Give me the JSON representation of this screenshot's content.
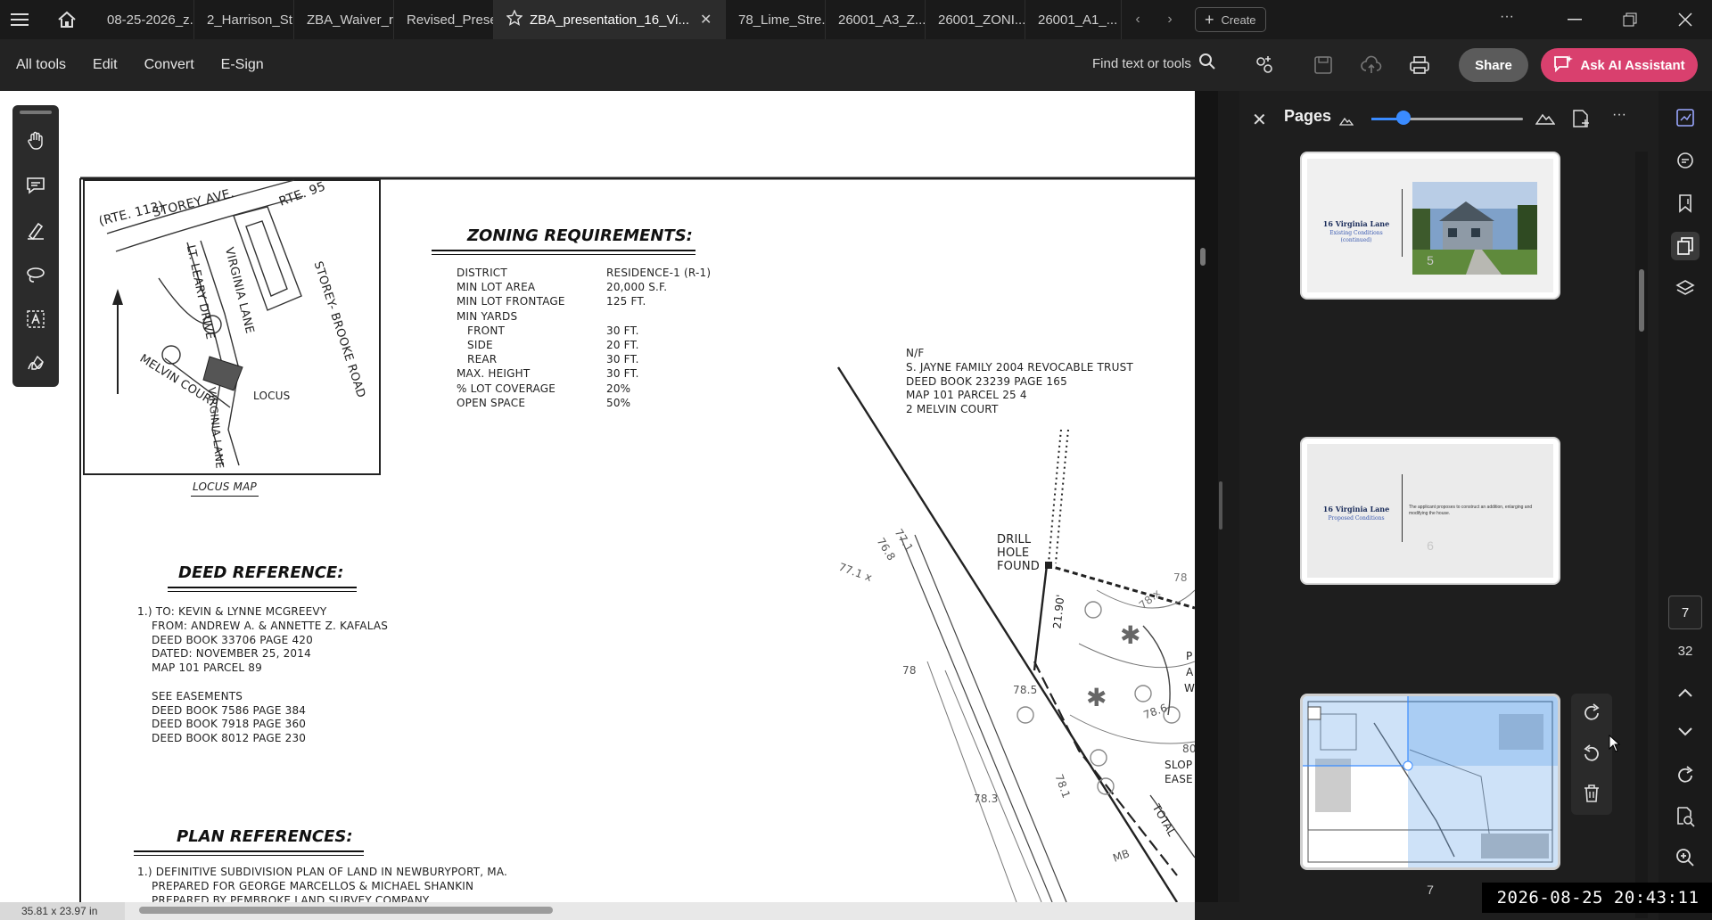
{
  "tabs": [
    {
      "label": "08-25-2026_z..."
    },
    {
      "label": "2_Harrison_St..."
    },
    {
      "label": "ZBA_Waiver_r..."
    },
    {
      "label": "Revised_Prese..."
    },
    {
      "label": "ZBA_presentation_16_Vi...",
      "active": true
    },
    {
      "label": "78_Lime_Stre..."
    },
    {
      "label": "26001_A3_Z..."
    },
    {
      "label": "26001_ZONI..."
    },
    {
      "label": "26001_A1_..."
    }
  ],
  "tabbar": {
    "create_label": "Create",
    "more": "···"
  },
  "menu": {
    "all_tools": "All tools",
    "edit": "Edit",
    "convert": "Convert",
    "esign": "E-Sign"
  },
  "toolbar": {
    "find_label": "Find text or tools",
    "share_label": "Share",
    "ai_label": "Ask AI Assistant"
  },
  "document": {
    "locus": {
      "rte113": "(RTE. 113)",
      "storey_ave": "STOREY AVE.",
      "rte95": "RTE. 95",
      "lt_leary": "LT. LEARY DRIVE",
      "virginia_lane": "VIRGINIA LANE",
      "storey_brooke": "STOREY- BROOKE ROAD",
      "melvin_court": "MELVIN COURT",
      "locus": "LOCUS",
      "virginia_lane2": "VIRGINIA LANE",
      "caption": "LOCUS MAP"
    },
    "zoning": {
      "title": "ZONING REQUIREMENTS:",
      "rows": [
        {
          "label": "DISTRICT",
          "value": "RESIDENCE-1 (R-1)"
        },
        {
          "label": "MIN LOT AREA",
          "value": "20,000 S.F."
        },
        {
          "label": "MIN LOT FRONTAGE",
          "value": "125 FT."
        },
        {
          "label": "MIN YARDS",
          "value": ""
        },
        {
          "label": "   FRONT",
          "value": "30 FT."
        },
        {
          "label": "   SIDE",
          "value": "20 FT."
        },
        {
          "label": "   REAR",
          "value": "30 FT."
        },
        {
          "label": "MAX. HEIGHT",
          "value": "30 FT."
        },
        {
          "label": "% LOT COVERAGE",
          "value": "20%"
        },
        {
          "label": "OPEN SPACE",
          "value": "50%"
        }
      ]
    },
    "deed": {
      "title": "DEED REFERENCE:",
      "lines": [
        "1.) TO: KEVIN & LYNNE MCGREEVY",
        "    FROM: ANDREW A. & ANNETTE Z. KAFALAS",
        "    DEED BOOK 33706 PAGE 420",
        "    DATED: NOVEMBER 25, 2014",
        "    MAP 101 PARCEL 89",
        "",
        "    SEE EASEMENTS",
        "    DEED BOOK 7586 PAGE 384",
        "    DEED BOOK 7918 PAGE 360",
        "    DEED BOOK 8012 PAGE 230"
      ]
    },
    "plan": {
      "title": "PLAN REFERENCES:",
      "lines": [
        "1.) DEFINITIVE SUBDIVISION PLAN OF LAND IN NEWBURYPORT, MA.",
        "    PREPARED FOR GEORGE MARCELLOS & MICHAEL SHANKIN",
        "    PREPARED BY PEMBROKE LAND SURVEY COMPANY"
      ]
    },
    "abutter": {
      "lines": [
        "N/F",
        "S. JAYNE FAMILY 2004 REVOCABLE TRUST",
        "DEED BOOK 23239 PAGE 165",
        "MAP 101 PARCEL 25 4",
        "2 MELVIN COURT"
      ]
    },
    "survey": {
      "drill": "DRILL\nHOLE\nFOUND",
      "dim": "21.90'",
      "e78": "78",
      "e785": "78.5",
      "e78x": "78.x",
      "e771": "77.1",
      "e768": "76.8",
      "e771b": "77.1 x",
      "e78b": "78",
      "e786": "78.6",
      "e781": "78.1",
      "e787": "78.7",
      "e783": "78.3",
      "e80": "80",
      "mb": "MB",
      "slope1": "SLOP",
      "slope2": "EASE",
      "total": "TOTAL",
      "a": "A",
      "w": "W",
      "p": "P"
    },
    "dimensions": "35.81 x 23.97 in"
  },
  "pages_panel": {
    "title": "Pages",
    "thumbs": [
      {
        "num": "5",
        "title": "16 Virginia Lane",
        "subtitle": "Existing Conditions (continued)"
      },
      {
        "num": "6",
        "title": "16 Virginia Lane",
        "subtitle": "Proposed Conditions",
        "body": "The applicant proposes to construct an addition, enlarging and modifying the house."
      },
      {
        "num": "7",
        "selected": true
      }
    ]
  },
  "page_nav": {
    "current": "7",
    "total": "32"
  },
  "timestamp": "2026-08-25  20:43:11",
  "colors": {
    "accent": "#3a8bff",
    "ai": "#d9406e",
    "panel": "#1e1e1e"
  }
}
